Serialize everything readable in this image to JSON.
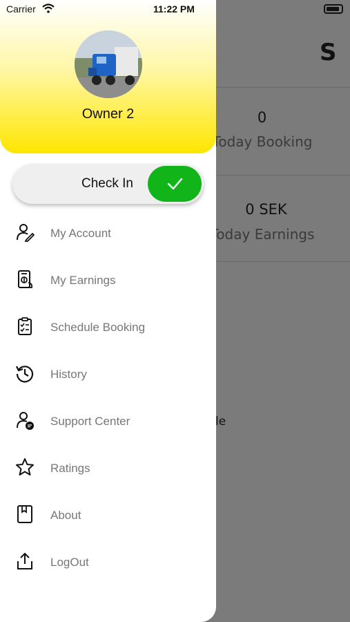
{
  "status_bar": {
    "carrier": "Carrier",
    "time": "11:22 PM"
  },
  "drawer": {
    "owner_name": "Owner 2",
    "check_in": {
      "label": "Check In",
      "state": "on",
      "knob_color": "#11b51a"
    },
    "menu": [
      {
        "label": "My Account",
        "icon": "user-edit-icon"
      },
      {
        "label": "My Earnings",
        "icon": "earnings-icon"
      },
      {
        "label": "Schedule Booking",
        "icon": "clipboard-list-icon"
      },
      {
        "label": "History",
        "icon": "history-icon"
      },
      {
        "label": "Support Center",
        "icon": "support-user-icon"
      },
      {
        "label": "Ratings",
        "icon": "star-icon"
      },
      {
        "label": "About",
        "icon": "book-icon"
      },
      {
        "label": "LogOut",
        "icon": "logout-icon"
      }
    ]
  },
  "background": {
    "today_booking_value": "0",
    "today_booking_label": "Today Booking",
    "today_earnings_value": "0 SEK",
    "today_earnings_label": "Today Earnings",
    "partial_text": "le"
  },
  "colors": {
    "header_yellow": "#ffe600",
    "overlay_gray": "#7b7b7b",
    "menu_text": "#777777"
  }
}
